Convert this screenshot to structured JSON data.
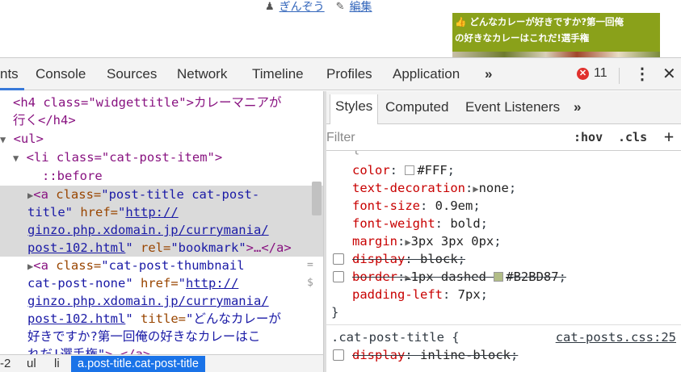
{
  "page": {
    "author": "ぎんぞう",
    "edit": "編集",
    "promo_line1": "どんなカレーが好きですか?第一回俺",
    "promo_line2": "の好きなカレーはこれだ!選手権"
  },
  "devtools_tabs": [
    "nts",
    "Console",
    "Sources",
    "Network",
    "Timeline",
    "Profiles",
    "Application",
    "»"
  ],
  "error_count": "11",
  "elements": {
    "line1a": "<h4 class=\"widgettitle\">カレーマニアが",
    "line1b": "行く</h4>",
    "ul_open": "<ul>",
    "li_open": "<li class=\"cat-post-item\">",
    "before": "::before",
    "a1_l1_tag": "<a",
    "a1_l1_attr": " class=",
    "a1_l1_val": "\"post-title cat-post-",
    "a1_l2_val": "title\"",
    "a1_l2_attr": " href=",
    "a1_l2_q": "\"",
    "a1_l2_link": "http://",
    "a1_l3_link": "ginzo.php.xdomain.jp/currymania/",
    "a1_l4_link": "post-102.html",
    "a1_l4_q": "\"",
    "a1_l4_attr": " rel=",
    "a1_l4_val": "\"bookmark\"",
    "a1_l4_tag": ">…</a>",
    "a2_l1_tag": "<a",
    "a2_l1_attr": " class=",
    "a2_l1_val": "\"cat-post-thumbnail",
    "a2_l2_val": "cat-post-none\"",
    "a2_l2_attr": " href=",
    "a2_l2_q": "\"",
    "a2_l2_link": "http://",
    "a2_l3_link": "ginzo.php.xdomain.jp/currymania/",
    "a2_l4_link": "post-102.html",
    "a2_l4_q": "\"",
    "a2_l4_attr": " title=",
    "a2_l4_val": "\"どんなカレーが",
    "a2_l5_val": "好きですか?第一回俺の好きなカレーはこ",
    "a2_l6_val": "れだ!選手権\"",
    "a2_l6_tag": ">…</a>"
  },
  "breadcrumbs": [
    "-2",
    "ul",
    "li",
    "a.post-title.cat-post-title"
  ],
  "styles_tabs": [
    "Styles",
    "Computed",
    "Event Listeners",
    "»"
  ],
  "filter_placeholder": "Filter",
  "hov": ":hov",
  "cls": ".cls",
  "plus": "+",
  "rule1": {
    "color_name": "color",
    "color_val": "#FFF",
    "color_swatch": "#ffffff",
    "td_name": "text-decoration",
    "td_val": "none",
    "fs_name": "font-size",
    "fs_val": "0.9em",
    "fw_name": "font-weight",
    "fw_val": "bold",
    "margin_name": "margin",
    "margin_val": "3px 3px 0px",
    "display_name": "display",
    "display_val": "block",
    "border_name": "border",
    "border_val": "1px dashed",
    "border_color": "#B2BD87",
    "border_swatch": "#b2bd87",
    "pl_name": "padding-left",
    "pl_val": "7px",
    "close": "}"
  },
  "rule2": {
    "selector": ".cat-post-title {",
    "source": "cat-posts.css:25",
    "display_name": "display",
    "display_val": "inline-block"
  }
}
